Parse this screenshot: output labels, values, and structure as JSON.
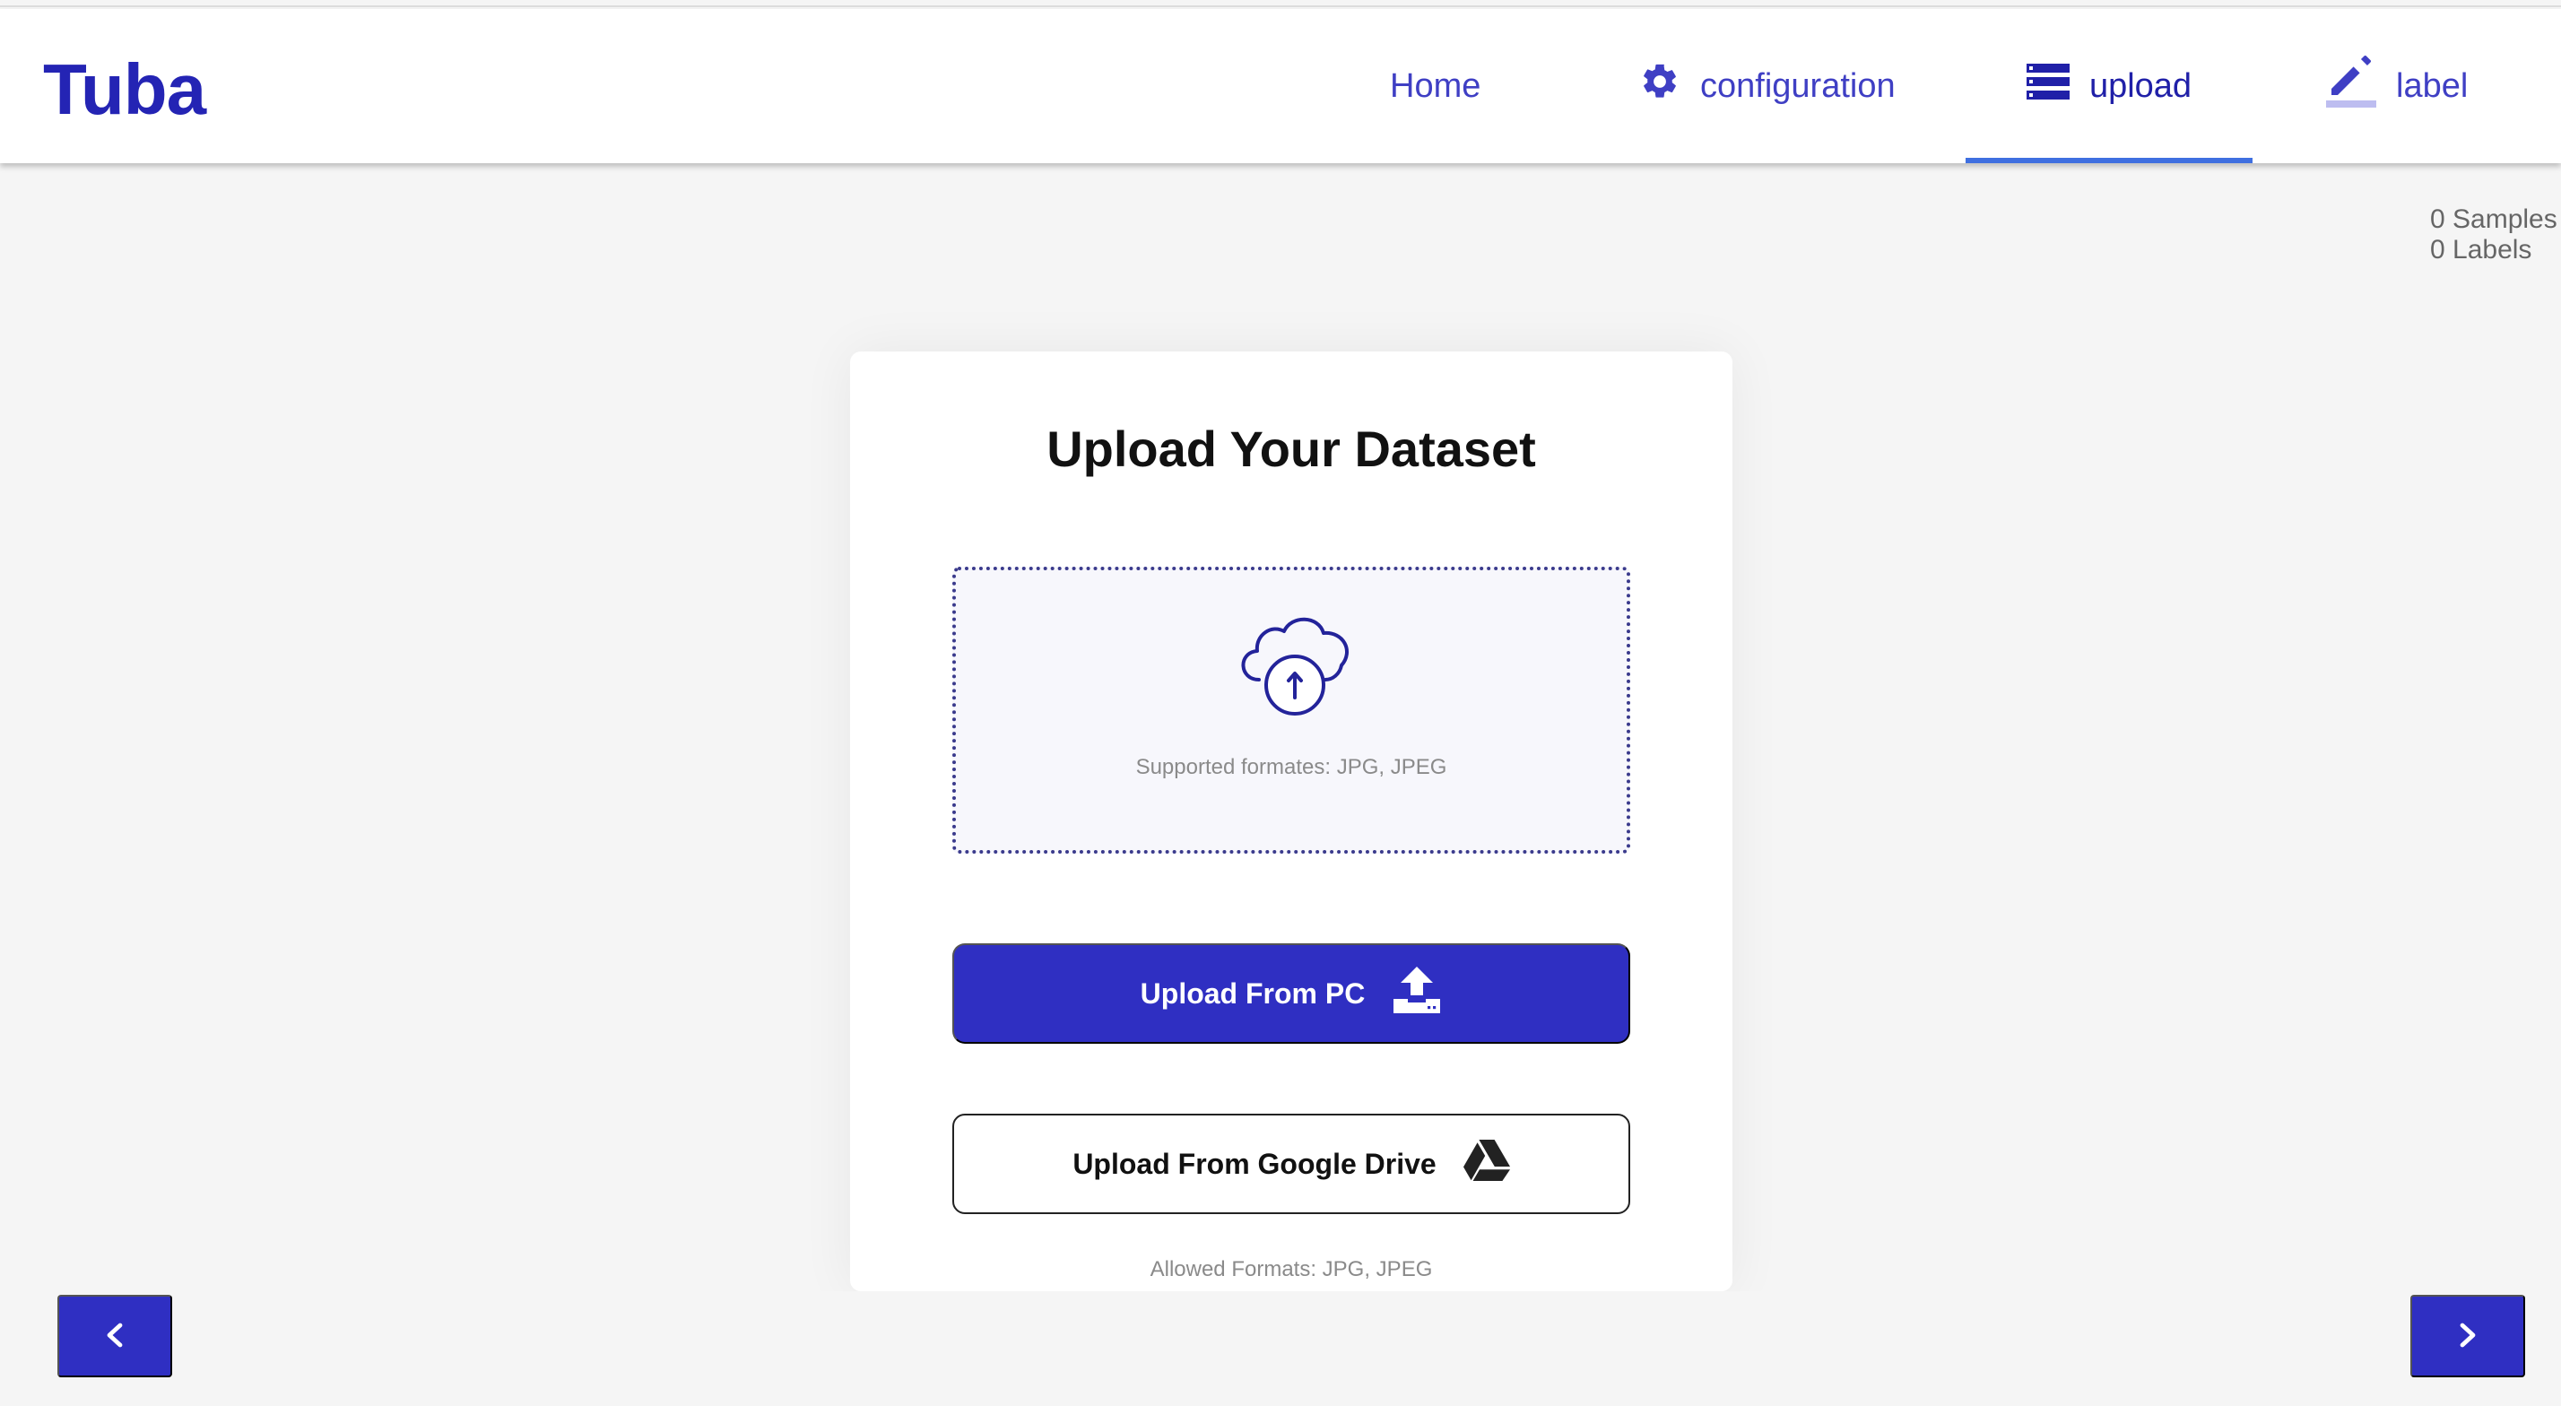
{
  "app": {
    "logo": "Tuba"
  },
  "nav": {
    "home": "Home",
    "configuration": "configuration",
    "upload": "upload",
    "label": "label"
  },
  "counts": {
    "samples": "0 Samples",
    "labels": "0 Labels"
  },
  "card": {
    "title": "Upload Your Dataset",
    "dropzone_hint": "Supported formates: JPG, JPEG",
    "upload_pc_label": "Upload From PC",
    "upload_drive_label": "Upload From Google Drive",
    "allowed_formats": "Allowed Formats: JPG, JPEG"
  },
  "colors": {
    "brand": "#2424b4",
    "primary_button": "#2f2fc2",
    "active_tab_indicator": "#3f6fe0",
    "nav_text": "#3f3fc4"
  },
  "icons": {
    "configuration": "gear-icon",
    "upload": "storage-list-icon",
    "label": "pencil-icon",
    "dropzone": "cloud-upload-icon",
    "upload_pc": "upload-tray-icon",
    "upload_drive": "google-drive-icon",
    "prev": "chevron-left-icon",
    "next": "chevron-right-icon"
  }
}
